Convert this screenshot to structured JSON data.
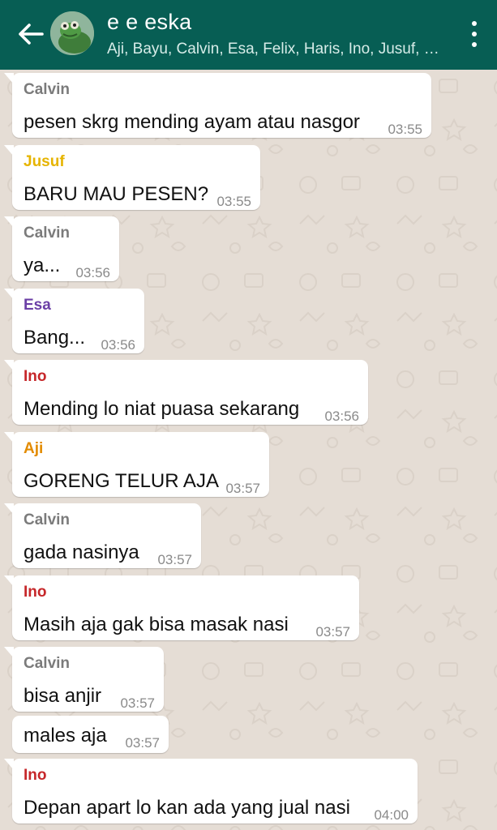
{
  "header": {
    "title": "e e eska",
    "members": "Aji, Bayu, Calvin, Esa, Felix, Haris, Ino, Jusuf, …"
  },
  "colors": {
    "header_bg": "#075e54",
    "chat_bg": "#e5ddd5",
    "Calvin": "#7b7b7b",
    "Jusuf": "#e6b400",
    "Esa": "#6b3fa6",
    "Ino": "#c6272a",
    "Aji": "#e38b00"
  },
  "messages": [
    {
      "sender": "Calvin",
      "text": "pesen skrg mending ayam atau nasgor",
      "time": "03:55"
    },
    {
      "sender": "Jusuf",
      "text": "BARU MAU PESEN?",
      "time": "03:55"
    },
    {
      "sender": "Calvin",
      "text": "ya...",
      "time": "03:56"
    },
    {
      "sender": "Esa",
      "text": "Bang...",
      "time": "03:56"
    },
    {
      "sender": "Ino",
      "text": "Mending lo niat puasa sekarang",
      "time": "03:56"
    },
    {
      "sender": "Aji",
      "text": "GORENG TELUR AJA",
      "time": "03:57"
    },
    {
      "sender": "Calvin",
      "text": "gada nasinya",
      "time": "03:57"
    },
    {
      "sender": "Ino",
      "text": "Masih aja gak bisa masak nasi",
      "time": "03:57"
    },
    {
      "sender": "Calvin",
      "text": "bisa anjir",
      "time": "03:57"
    },
    {
      "sender": "",
      "text": "males aja",
      "time": "03:57"
    },
    {
      "sender": "Ino",
      "text": "Depan apart lo kan ada yang jual nasi",
      "time": "04:00"
    }
  ]
}
